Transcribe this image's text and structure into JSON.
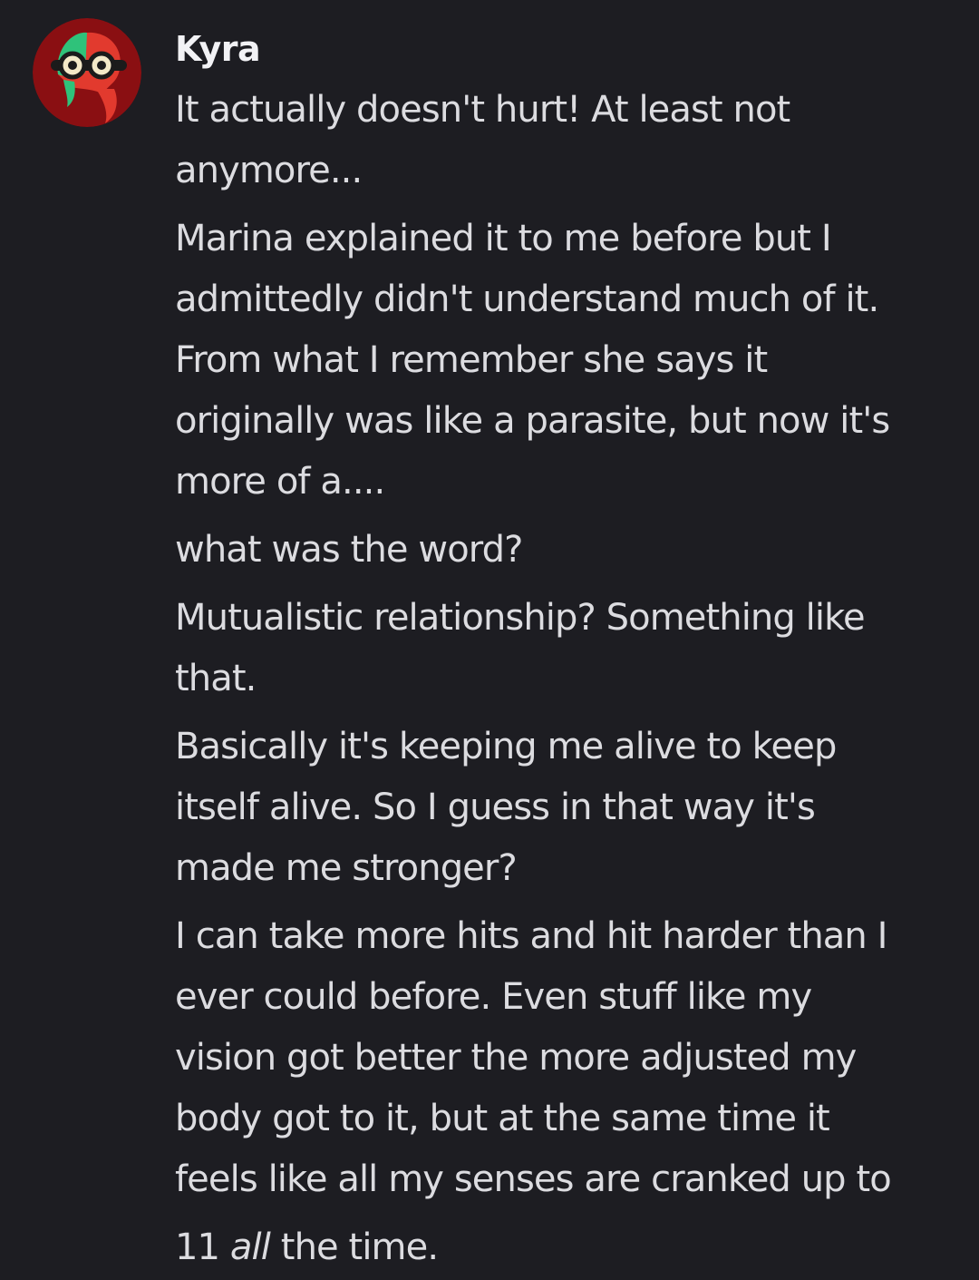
{
  "message": {
    "author": "Kyra",
    "paragraphs": [
      [
        "It actually doesn't hurt! At least not",
        "anymore..."
      ],
      [
        "Marina explained it to me before but I",
        "admittedly didn't understand much of it.",
        "From what I remember she says it",
        "originally was like a parasite, but now it's",
        "more of a...."
      ],
      [
        "what was the word?"
      ],
      [
        "Mutualistic relationship? Something like",
        "that."
      ],
      [
        "Basically it's keeping me alive to keep",
        "itself alive. So I guess in that way it's",
        "made me stronger?"
      ],
      [
        "I can take more hits and hit harder than I",
        "ever could before. Even stuff like my",
        "vision got better the more adjusted my",
        "body got to it, but at the same time it",
        "feels like all my senses are cranked up to"
      ]
    ],
    "last_line": {
      "before": "11 ",
      "emphasis": "all",
      "after": " the time."
    }
  },
  "colors": {
    "background": "#1d1d22",
    "text": "#dcdce0",
    "username": "#f2f2f5",
    "avatar_bg": "#8a0f12"
  },
  "icons": {
    "avatar": "kyra-avatar-icon"
  }
}
